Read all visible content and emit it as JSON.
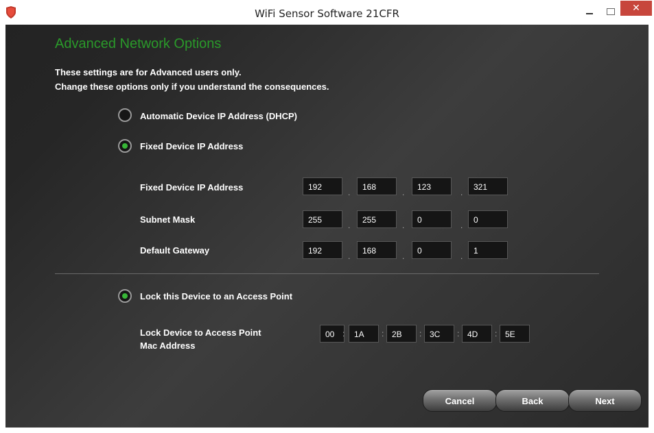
{
  "window": {
    "title": "WiFi Sensor Software 21CFR",
    "close_glyph": "✕",
    "icons": [
      "app-shield-icon",
      "minimize-icon",
      "maximize-icon",
      "close-icon"
    ]
  },
  "page": {
    "heading": "Advanced Network Options",
    "intro_line1": "These settings are for Advanced users only.",
    "intro_line2": "Change these options only if you understand the consequences."
  },
  "options": {
    "dhcp": {
      "label": "Automatic Device IP Address (DHCP)",
      "selected": false
    },
    "fixed": {
      "label": "Fixed Device IP Address",
      "selected": true
    },
    "lock": {
      "label": "Lock this Device to an Access Point",
      "selected": true
    }
  },
  "ip": {
    "ip_label": "Fixed Device IP Address",
    "ip_octets": [
      "192",
      "168",
      "123",
      "321"
    ],
    "subnet_label": "Subnet Mask",
    "subnet_octets": [
      "255",
      "255",
      "0",
      "0"
    ],
    "gateway_label": "Default Gateway",
    "gateway_octets": [
      "192",
      "168",
      "0",
      "1"
    ],
    "separator": "."
  },
  "mac": {
    "label_line1": "Lock Device to Access Point",
    "label_line2": "Mac Address",
    "segments": [
      "00",
      "1A",
      "2B",
      "3C",
      "4D",
      "5E"
    ],
    "separator": ":"
  },
  "buttons": {
    "cancel": "Cancel",
    "back": "Back",
    "next": "Next"
  },
  "colors": {
    "heading": "#2a9a2a",
    "radio_selected": "#37b637",
    "close_button": "#c7463c"
  }
}
